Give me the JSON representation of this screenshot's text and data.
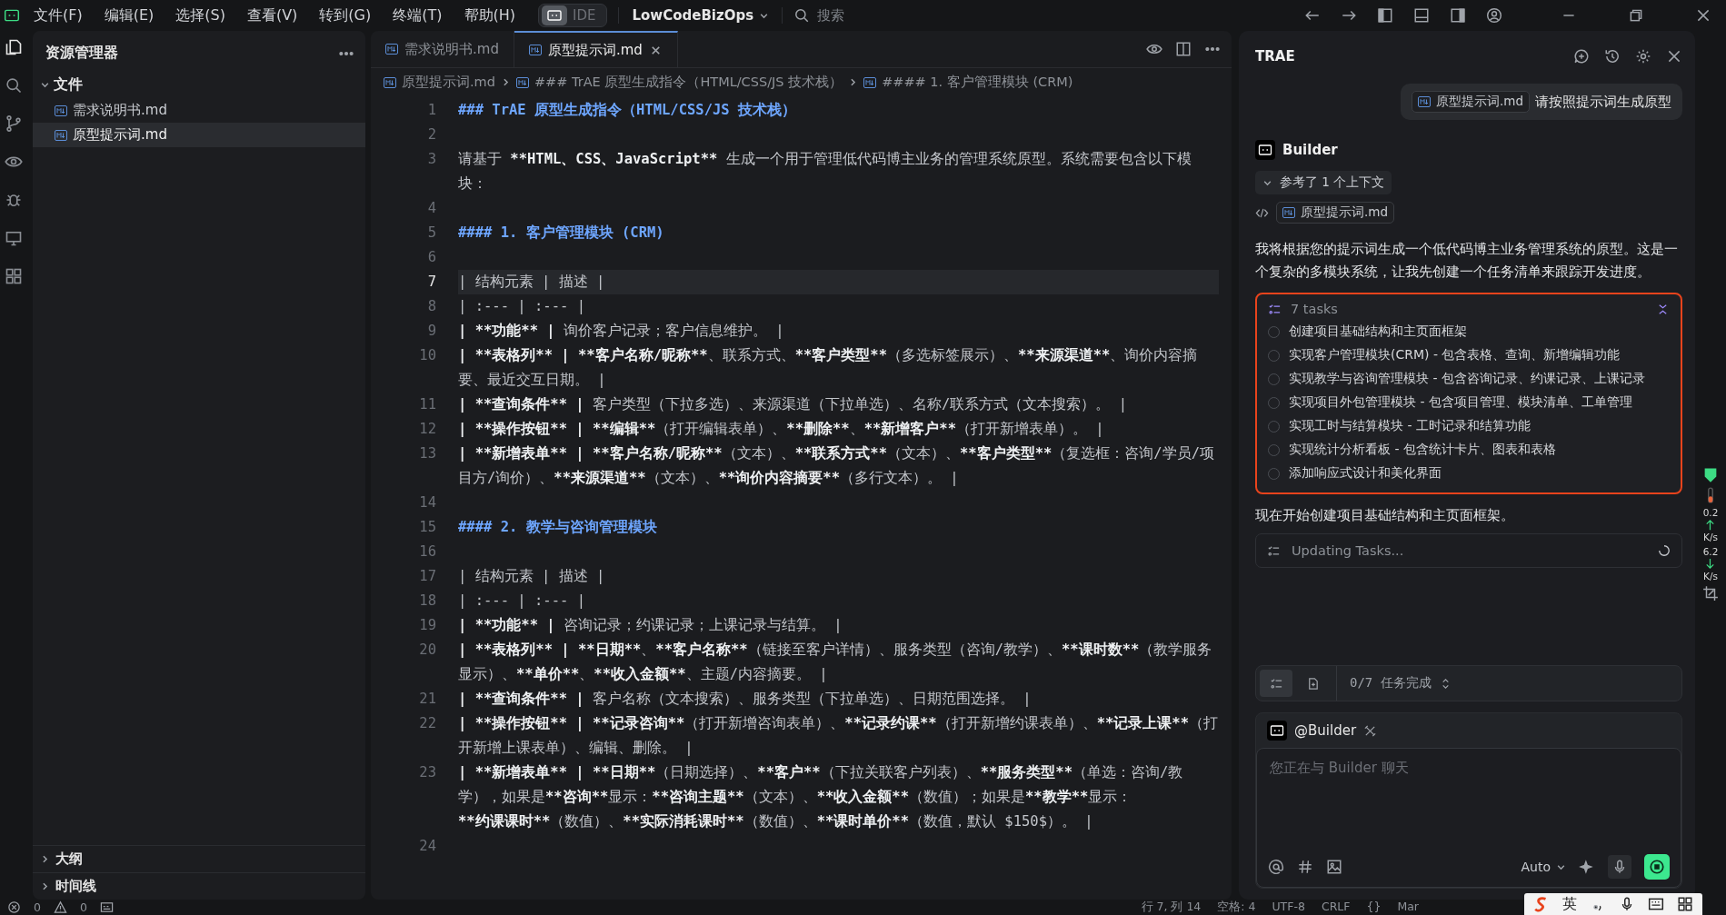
{
  "menu_bar": {
    "items": [
      "文件(F)",
      "编辑(E)",
      "选择(S)",
      "查看(V)",
      "转到(G)",
      "终端(T)",
      "帮助(H)"
    ],
    "mode_toggle": {
      "label": "IDE",
      "selected": false
    },
    "project": "LowCodeBizOps",
    "search": {
      "placeholder": "搜索"
    }
  },
  "explorer": {
    "title": "资源管理器",
    "folder": {
      "label": "文件",
      "expanded": true,
      "children": [
        {
          "label": "需求说明书.md",
          "selected": false
        },
        {
          "label": "原型提示词.md",
          "selected": true
        }
      ]
    },
    "sections": [
      {
        "label": "大纲",
        "expanded": false
      },
      {
        "label": "时间线",
        "expanded": false
      }
    ]
  },
  "editor": {
    "tabs": [
      {
        "label": "需求说明书.md",
        "selected": false
      },
      {
        "label": "原型提示词.md",
        "selected": true
      }
    ],
    "breadcrumb": [
      "原型提示词.md",
      "### TrAE 原型生成指令（HTML/CSS/JS 技术栈）",
      "#### 1. 客户管理模块 (CRM)"
    ],
    "lines": [
      {
        "num": "1",
        "current": false,
        "kind": "heading",
        "segments": [
          {
            "t": "### TrAE 原型生成指令（HTML/CSS/JS 技术栈）"
          }
        ]
      },
      {
        "num": "2",
        "current": false,
        "kind": "blank"
      },
      {
        "num": "3",
        "current": false,
        "kind": "text",
        "segments": [
          {
            "t": "请基于 "
          },
          {
            "t": "**HTML、CSS、JavaScript**",
            "b": true
          },
          {
            "t": " 生成一个用于管理低代码博主业务的管理系统原型。系统需要包含以下模块："
          }
        ]
      },
      {
        "num": "4",
        "current": false,
        "kind": "blank"
      },
      {
        "num": "5",
        "current": false,
        "kind": "heading",
        "segments": [
          {
            "t": "#### 1. 客户管理模块 (CRM)"
          }
        ]
      },
      {
        "num": "6",
        "current": false,
        "kind": "blank"
      },
      {
        "num": "7",
        "current": true,
        "kind": "text",
        "segments": [
          {
            "t": "| 结构元素 | 描述 |"
          }
        ]
      },
      {
        "num": "8",
        "current": false,
        "kind": "text",
        "segments": [
          {
            "t": "| :--- | :--- |"
          }
        ]
      },
      {
        "num": "9",
        "current": false,
        "kind": "text",
        "segments": [
          {
            "t": "| **功能** |",
            "b": true
          },
          {
            "t": " 询价客户记录；客户信息维护。 |"
          }
        ]
      },
      {
        "num": "10",
        "current": false,
        "kind": "text",
        "segments": [
          {
            "t": "| **表格列** | **客户名称/昵称**",
            "b": true
          },
          {
            "t": "、联系方式、"
          },
          {
            "t": "**客户类型**",
            "b": true
          },
          {
            "t": "（多选标签展示）、"
          },
          {
            "t": "**来源渠道**",
            "b": true
          },
          {
            "t": "、询价内容摘要、最近交互日期。 |"
          }
        ]
      },
      {
        "num": "11",
        "current": false,
        "kind": "text",
        "segments": [
          {
            "t": "| **查询条件** |",
            "b": true
          },
          {
            "t": " 客户类型（下拉多选）、来源渠道（下拉单选）、名称/联系方式（文本搜索）。 |"
          }
        ]
      },
      {
        "num": "12",
        "current": false,
        "kind": "text",
        "segments": [
          {
            "t": "| **操作按钮** | **编辑**",
            "b": true
          },
          {
            "t": "（打开编辑表单）、"
          },
          {
            "t": "**删除**",
            "b": true
          },
          {
            "t": "、"
          },
          {
            "t": "**新增客户**",
            "b": true
          },
          {
            "t": "（打开新增表单）。 |"
          }
        ]
      },
      {
        "num": "13",
        "current": false,
        "kind": "text",
        "segments": [
          {
            "t": "| **新增表单** | **客户名称/昵称**",
            "b": true
          },
          {
            "t": "（文本）、"
          },
          {
            "t": "**联系方式**",
            "b": true
          },
          {
            "t": "（文本）、"
          },
          {
            "t": "**客户类型**",
            "b": true
          },
          {
            "t": "（复选框：咨询/学员/项目方/询价）、"
          },
          {
            "t": "**来源渠道**",
            "b": true
          },
          {
            "t": "（文本）、"
          },
          {
            "t": "**询价内容摘要**",
            "b": true
          },
          {
            "t": "（多行文本）。 |"
          }
        ]
      },
      {
        "num": "14",
        "current": false,
        "kind": "blank"
      },
      {
        "num": "15",
        "current": false,
        "kind": "heading",
        "segments": [
          {
            "t": "#### 2. 教学与咨询管理模块"
          }
        ]
      },
      {
        "num": "16",
        "current": false,
        "kind": "blank"
      },
      {
        "num": "17",
        "current": false,
        "kind": "text",
        "segments": [
          {
            "t": "| 结构元素 | 描述 |"
          }
        ]
      },
      {
        "num": "18",
        "current": false,
        "kind": "text",
        "segments": [
          {
            "t": "| :--- | :--- |"
          }
        ]
      },
      {
        "num": "19",
        "current": false,
        "kind": "text",
        "segments": [
          {
            "t": "| **功能** |",
            "b": true
          },
          {
            "t": " 咨询记录；约课记录；上课记录与结算。 |"
          }
        ]
      },
      {
        "num": "20",
        "current": false,
        "kind": "text",
        "segments": [
          {
            "t": "| **表格列** | **日期**",
            "b": true
          },
          {
            "t": "、"
          },
          {
            "t": "**客户名称**",
            "b": true
          },
          {
            "t": "（链接至客户详情）、服务类型（咨询/教学）、"
          },
          {
            "t": "**课时数**",
            "b": true
          },
          {
            "t": "（教学服务显示）、"
          },
          {
            "t": "**单价**",
            "b": true
          },
          {
            "t": "、"
          },
          {
            "t": "**收入金额**",
            "b": true
          },
          {
            "t": "、主题/内容摘要。 |"
          }
        ]
      },
      {
        "num": "21",
        "current": false,
        "kind": "text",
        "segments": [
          {
            "t": "| **查询条件** |",
            "b": true
          },
          {
            "t": " 客户名称（文本搜索）、服务类型（下拉单选）、日期范围选择。 |"
          }
        ]
      },
      {
        "num": "22",
        "current": false,
        "kind": "text",
        "segments": [
          {
            "t": "| **操作按钮** | **记录咨询**",
            "b": true
          },
          {
            "t": "（打开新增咨询表单）、"
          },
          {
            "t": "**记录约课**",
            "b": true
          },
          {
            "t": "（打开新增约课表单）、"
          },
          {
            "t": "**记录上课**",
            "b": true
          },
          {
            "t": "（打开新增上课表单）、编辑、删除。 |"
          }
        ]
      },
      {
        "num": "23",
        "current": false,
        "kind": "text",
        "segments": [
          {
            "t": "| **新增表单** | **日期**",
            "b": true
          },
          {
            "t": "（日期选择）、"
          },
          {
            "t": "**客户**",
            "b": true
          },
          {
            "t": "（下拉关联客户列表）、"
          },
          {
            "t": "**服务类型**",
            "b": true
          },
          {
            "t": "（单选：咨询/教学），如果是"
          },
          {
            "t": "**咨询**",
            "b": true
          },
          {
            "t": "显示："
          },
          {
            "t": "**咨询主题**",
            "b": true
          },
          {
            "t": "（文本）、"
          },
          {
            "t": "**收入金额**",
            "b": true
          },
          {
            "t": "（数值）；如果是"
          },
          {
            "t": "**教学**",
            "b": true
          },
          {
            "t": "显示："
          },
          {
            "t": "**约课课时**",
            "b": true
          },
          {
            "t": "（数值）、"
          },
          {
            "t": "**实际消耗课时**",
            "b": true
          },
          {
            "t": "（数值）、"
          },
          {
            "t": "**课时单价**",
            "b": true
          },
          {
            "t": "（数值，默认 $150$）。 |"
          }
        ]
      },
      {
        "num": "24",
        "current": false,
        "kind": "blank"
      }
    ]
  },
  "assistant": {
    "title": "TRAE",
    "user_message": {
      "file": "原型提示词.md",
      "text": "请按照提示词生成原型"
    },
    "agent": "Builder",
    "context": {
      "label": "参考了 1 个上下文",
      "expanded": true,
      "file": "原型提示词.md"
    },
    "reply": "我将根据您的提示词生成一个低代码博主业务管理系统的原型。这是一个复杂的多模块系统，让我先创建一个任务清单来跟踪开发进度。",
    "tasks": {
      "title": "7 tasks",
      "highlighted": true,
      "items": [
        {
          "label": "创建项目基础结构和主页面框架",
          "checked": false
        },
        {
          "label": "实现客户管理模块(CRM) - 包含表格、查询、新增编辑功能",
          "checked": false
        },
        {
          "label": "实现教学与咨询管理模块 - 包含咨询记录、约课记录、上课记录",
          "checked": false
        },
        {
          "label": "实现项目外包管理模块 - 包含项目管理、模块清单、工单管理",
          "checked": false
        },
        {
          "label": "实现工时与结算模块 - 工时记录和结算功能",
          "checked": false
        },
        {
          "label": "实现统计分析看板 - 包含统计卡片、图表和表格",
          "checked": false
        },
        {
          "label": "添加响应式设计和美化界面",
          "checked": false
        }
      ]
    },
    "status_text": "现在开始创建项目基础结构和主页面框架。",
    "updating": "Updating Tasks...",
    "progress": "0/7 任务完成",
    "composer": {
      "agent": "@Builder",
      "placeholder": "您正在与 Builder 聊天",
      "model": "Auto"
    }
  },
  "net_meter": [
    {
      "value": "0.2",
      "unit": "K/s",
      "kind": "up"
    },
    {
      "value": "6.2",
      "unit": "K/s",
      "kind": "down"
    }
  ],
  "status_bar": {
    "errors": "0",
    "warnings": "0",
    "items": [
      "行 7, 列 14",
      "空格: 4",
      "UTF-8",
      "CRLF",
      "{}",
      "Mar"
    ]
  },
  "ime_bar": {
    "mode": "英"
  }
}
